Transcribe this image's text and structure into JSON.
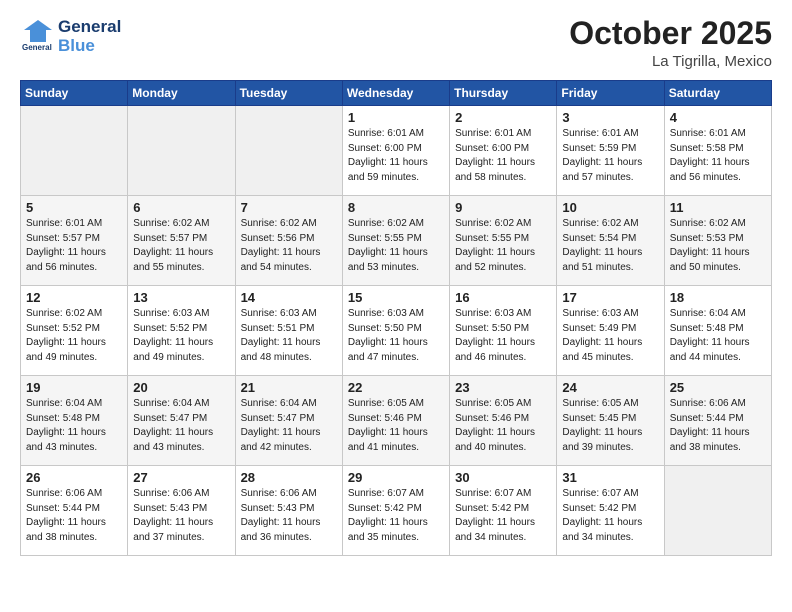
{
  "header": {
    "logo_line1": "General",
    "logo_line2": "Blue",
    "month": "October 2025",
    "location": "La Tigrilla, Mexico"
  },
  "days_of_week": [
    "Sunday",
    "Monday",
    "Tuesday",
    "Wednesday",
    "Thursday",
    "Friday",
    "Saturday"
  ],
  "weeks": [
    [
      {
        "num": "",
        "info": ""
      },
      {
        "num": "",
        "info": ""
      },
      {
        "num": "",
        "info": ""
      },
      {
        "num": "1",
        "info": "Sunrise: 6:01 AM\nSunset: 6:00 PM\nDaylight: 11 hours\nand 59 minutes."
      },
      {
        "num": "2",
        "info": "Sunrise: 6:01 AM\nSunset: 6:00 PM\nDaylight: 11 hours\nand 58 minutes."
      },
      {
        "num": "3",
        "info": "Sunrise: 6:01 AM\nSunset: 5:59 PM\nDaylight: 11 hours\nand 57 minutes."
      },
      {
        "num": "4",
        "info": "Sunrise: 6:01 AM\nSunset: 5:58 PM\nDaylight: 11 hours\nand 56 minutes."
      }
    ],
    [
      {
        "num": "5",
        "info": "Sunrise: 6:01 AM\nSunset: 5:57 PM\nDaylight: 11 hours\nand 56 minutes."
      },
      {
        "num": "6",
        "info": "Sunrise: 6:02 AM\nSunset: 5:57 PM\nDaylight: 11 hours\nand 55 minutes."
      },
      {
        "num": "7",
        "info": "Sunrise: 6:02 AM\nSunset: 5:56 PM\nDaylight: 11 hours\nand 54 minutes."
      },
      {
        "num": "8",
        "info": "Sunrise: 6:02 AM\nSunset: 5:55 PM\nDaylight: 11 hours\nand 53 minutes."
      },
      {
        "num": "9",
        "info": "Sunrise: 6:02 AM\nSunset: 5:55 PM\nDaylight: 11 hours\nand 52 minutes."
      },
      {
        "num": "10",
        "info": "Sunrise: 6:02 AM\nSunset: 5:54 PM\nDaylight: 11 hours\nand 51 minutes."
      },
      {
        "num": "11",
        "info": "Sunrise: 6:02 AM\nSunset: 5:53 PM\nDaylight: 11 hours\nand 50 minutes."
      }
    ],
    [
      {
        "num": "12",
        "info": "Sunrise: 6:02 AM\nSunset: 5:52 PM\nDaylight: 11 hours\nand 49 minutes."
      },
      {
        "num": "13",
        "info": "Sunrise: 6:03 AM\nSunset: 5:52 PM\nDaylight: 11 hours\nand 49 minutes."
      },
      {
        "num": "14",
        "info": "Sunrise: 6:03 AM\nSunset: 5:51 PM\nDaylight: 11 hours\nand 48 minutes."
      },
      {
        "num": "15",
        "info": "Sunrise: 6:03 AM\nSunset: 5:50 PM\nDaylight: 11 hours\nand 47 minutes."
      },
      {
        "num": "16",
        "info": "Sunrise: 6:03 AM\nSunset: 5:50 PM\nDaylight: 11 hours\nand 46 minutes."
      },
      {
        "num": "17",
        "info": "Sunrise: 6:03 AM\nSunset: 5:49 PM\nDaylight: 11 hours\nand 45 minutes."
      },
      {
        "num": "18",
        "info": "Sunrise: 6:04 AM\nSunset: 5:48 PM\nDaylight: 11 hours\nand 44 minutes."
      }
    ],
    [
      {
        "num": "19",
        "info": "Sunrise: 6:04 AM\nSunset: 5:48 PM\nDaylight: 11 hours\nand 43 minutes."
      },
      {
        "num": "20",
        "info": "Sunrise: 6:04 AM\nSunset: 5:47 PM\nDaylight: 11 hours\nand 43 minutes."
      },
      {
        "num": "21",
        "info": "Sunrise: 6:04 AM\nSunset: 5:47 PM\nDaylight: 11 hours\nand 42 minutes."
      },
      {
        "num": "22",
        "info": "Sunrise: 6:05 AM\nSunset: 5:46 PM\nDaylight: 11 hours\nand 41 minutes."
      },
      {
        "num": "23",
        "info": "Sunrise: 6:05 AM\nSunset: 5:46 PM\nDaylight: 11 hours\nand 40 minutes."
      },
      {
        "num": "24",
        "info": "Sunrise: 6:05 AM\nSunset: 5:45 PM\nDaylight: 11 hours\nand 39 minutes."
      },
      {
        "num": "25",
        "info": "Sunrise: 6:06 AM\nSunset: 5:44 PM\nDaylight: 11 hours\nand 38 minutes."
      }
    ],
    [
      {
        "num": "26",
        "info": "Sunrise: 6:06 AM\nSunset: 5:44 PM\nDaylight: 11 hours\nand 38 minutes."
      },
      {
        "num": "27",
        "info": "Sunrise: 6:06 AM\nSunset: 5:43 PM\nDaylight: 11 hours\nand 37 minutes."
      },
      {
        "num": "28",
        "info": "Sunrise: 6:06 AM\nSunset: 5:43 PM\nDaylight: 11 hours\nand 36 minutes."
      },
      {
        "num": "29",
        "info": "Sunrise: 6:07 AM\nSunset: 5:42 PM\nDaylight: 11 hours\nand 35 minutes."
      },
      {
        "num": "30",
        "info": "Sunrise: 6:07 AM\nSunset: 5:42 PM\nDaylight: 11 hours\nand 34 minutes."
      },
      {
        "num": "31",
        "info": "Sunrise: 6:07 AM\nSunset: 5:42 PM\nDaylight: 11 hours\nand 34 minutes."
      },
      {
        "num": "",
        "info": ""
      }
    ]
  ]
}
